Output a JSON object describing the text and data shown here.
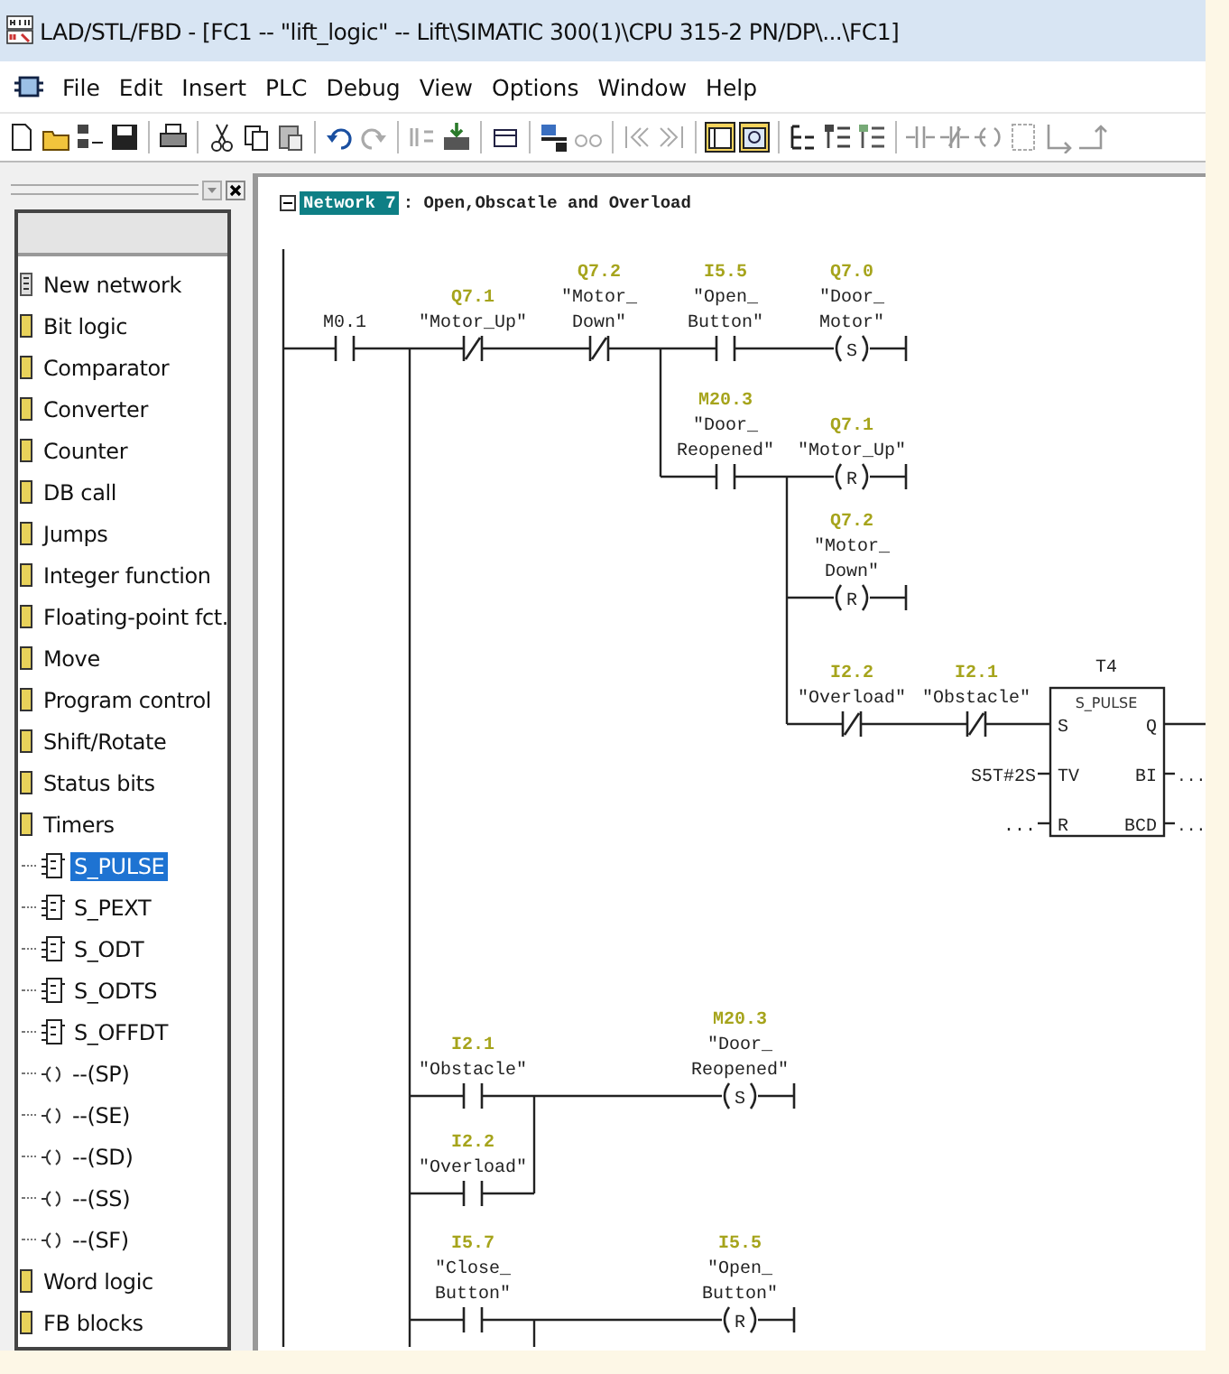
{
  "window": {
    "title": "LAD/STL/FBD  - [FC1 -- \"lift_logic\" -- Lift\\SIMATIC 300(1)\\CPU 315-2 PN/DP\\...\\FC1]"
  },
  "menu": [
    "File",
    "Edit",
    "Insert",
    "PLC",
    "Debug",
    "View",
    "Options",
    "Window",
    "Help"
  ],
  "catalog": {
    "items": [
      {
        "label": "New network",
        "kind": "network",
        "selected": false
      },
      {
        "label": "Bit logic",
        "kind": "folder",
        "selected": false
      },
      {
        "label": "Comparator",
        "kind": "folder",
        "selected": false
      },
      {
        "label": "Converter",
        "kind": "folder",
        "selected": false
      },
      {
        "label": "Counter",
        "kind": "folder",
        "selected": false
      },
      {
        "label": "DB call",
        "kind": "folder",
        "selected": false
      },
      {
        "label": "Jumps",
        "kind": "folder",
        "selected": false
      },
      {
        "label": "Integer function",
        "kind": "folder",
        "selected": false
      },
      {
        "label": "Floating-point fct.",
        "kind": "folder",
        "selected": false
      },
      {
        "label": "Move",
        "kind": "folder",
        "selected": false
      },
      {
        "label": "Program control",
        "kind": "folder",
        "selected": false
      },
      {
        "label": "Shift/Rotate",
        "kind": "folder",
        "selected": false
      },
      {
        "label": "Status bits",
        "kind": "folder",
        "selected": false
      },
      {
        "label": "Timers",
        "kind": "folder",
        "selected": false,
        "children": [
          {
            "label": "S_PULSE",
            "kind": "box",
            "selected": true
          },
          {
            "label": "S_PEXT",
            "kind": "box",
            "selected": false
          },
          {
            "label": "S_ODT",
            "kind": "box",
            "selected": false
          },
          {
            "label": "S_ODTS",
            "kind": "box",
            "selected": false
          },
          {
            "label": "S_OFFDT",
            "kind": "box",
            "selected": false
          },
          {
            "label": "--(SP)",
            "kind": "coil",
            "selected": false
          },
          {
            "label": "--(SE)",
            "kind": "coil",
            "selected": false
          },
          {
            "label": "--(SD)",
            "kind": "coil",
            "selected": false
          },
          {
            "label": "--(SS)",
            "kind": "coil",
            "selected": false
          },
          {
            "label": "--(SF)",
            "kind": "coil",
            "selected": false
          }
        ]
      },
      {
        "label": "Word logic",
        "kind": "folder",
        "selected": false
      },
      {
        "label": "FB blocks",
        "kind": "folder",
        "selected": false
      }
    ]
  },
  "network": {
    "label": "Network 7",
    "comment": ": Open,Obscatle and Overload"
  },
  "ladder": [
    {
      "kind": "no_contact",
      "address": "M0.1"
    },
    {
      "kind": "nc_contact",
      "address": "Q7.1",
      "symbol": [
        "\"Motor_Up\""
      ]
    },
    {
      "kind": "nc_contact",
      "address": "Q7.2",
      "symbol": [
        "\"Motor_",
        "Down\""
      ]
    },
    {
      "kind": "no_contact",
      "address": "I5.5",
      "symbol": [
        "\"Open_",
        "Button\""
      ]
    },
    {
      "kind": "coil",
      "letter": "S",
      "address": "Q7.0",
      "symbol": [
        "\"Door_",
        "Motor\""
      ]
    },
    {
      "kind": "no_contact",
      "address": "M20.3",
      "symbol": [
        "\"Door_",
        "Reopened\""
      ]
    },
    {
      "kind": "coil",
      "letter": "R",
      "address": "Q7.1",
      "symbol": [
        "\"Motor_Up\""
      ]
    },
    {
      "kind": "coil",
      "letter": "R",
      "address": "Q7.2",
      "symbol": [
        "\"Motor_",
        "Down\""
      ]
    },
    {
      "kind": "nc_contact",
      "address": "I2.2",
      "symbol": [
        "\"Overload\""
      ]
    },
    {
      "kind": "nc_contact",
      "address": "I2.1",
      "symbol": [
        "\"Obstacle\""
      ]
    },
    {
      "kind": "timer",
      "name": "T4",
      "type": "S_PULSE",
      "inputs": [
        {
          "pin": "S"
        },
        {
          "pin": "TV",
          "value": "S5T#2S"
        },
        {
          "pin": "R",
          "value": "..."
        }
      ],
      "outputs": [
        {
          "pin": "Q"
        },
        {
          "pin": "BI",
          "value": "..."
        },
        {
          "pin": "BCD",
          "value": "..."
        }
      ]
    },
    {
      "kind": "no_contact",
      "address": "I2.1",
      "symbol": [
        "\"Obstacle\""
      ]
    },
    {
      "kind": "coil",
      "letter": "S",
      "address": "M20.3",
      "symbol": [
        "\"Door_",
        "Reopened\""
      ]
    },
    {
      "kind": "no_contact",
      "address": "I2.2",
      "symbol": [
        "\"Overload\""
      ]
    },
    {
      "kind": "no_contact",
      "address": "I5.7",
      "symbol": [
        "\"Close_",
        "Button\""
      ]
    },
    {
      "kind": "coil",
      "letter": "R",
      "address": "I5.5",
      "symbol": [
        "\"Open_",
        "Button\""
      ]
    }
  ]
}
